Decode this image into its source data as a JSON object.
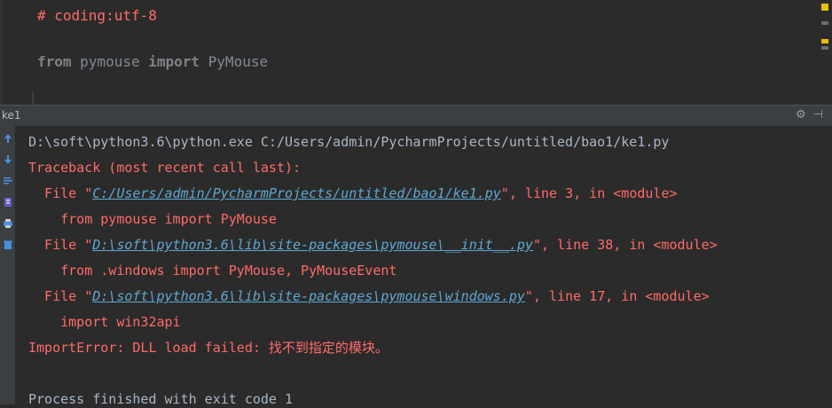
{
  "editor": {
    "line1": "# coding:utf-8",
    "line2_kw1": "from",
    "line2_mod": " pymouse ",
    "line2_kw2": "import",
    "line2_name": " PyMouse"
  },
  "panel": {
    "title": "ke1",
    "gear": "⚙",
    "dash": "⊣"
  },
  "console": {
    "cmd": "D:\\soft\\python3.6\\python.exe C:/Users/admin/PycharmProjects/untitled/bao1/ke1.py",
    "traceback": "Traceback (most recent call last):",
    "frames": [
      {
        "pre": "  File \"",
        "path": "C:/Users/admin/PycharmProjects/untitled/bao1/ke1.py",
        "post": "\", line 3, in <module>",
        "code": "    from pymouse import PyMouse"
      },
      {
        "pre": "  File \"",
        "path": "D:\\soft\\python3.6\\lib\\site-packages\\pymouse\\__init__.py",
        "post": "\", line 38, in <module>",
        "code": "    from .windows import PyMouse, PyMouseEvent"
      },
      {
        "pre": "  File \"",
        "path": "D:\\soft\\python3.6\\lib\\site-packages\\pymouse\\windows.py",
        "post": "\", line 17, in <module>",
        "code": "    import win32api"
      }
    ],
    "error": "ImportError: DLL load failed: 找不到指定的模块。",
    "finished": "Process finished with exit code 1"
  },
  "icons": [
    "up-arrow-icon",
    "down-arrow-icon",
    "soft-wrap-icon",
    "scroll-to-end-icon",
    "print-icon",
    "trash-icon"
  ],
  "colors": {
    "error": "#ff6b68",
    "link": "#5fa8d3",
    "text": "#a9b7c6",
    "background": "#2b2b2b"
  }
}
